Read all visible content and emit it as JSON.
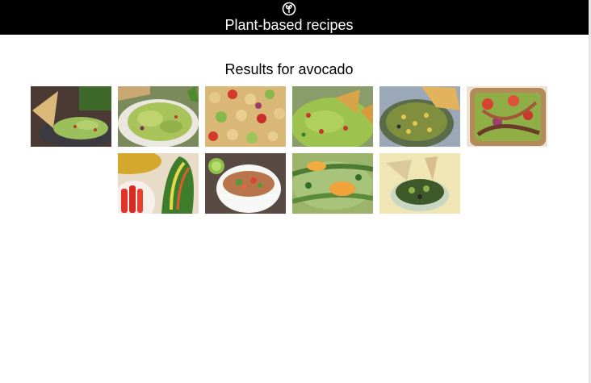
{
  "header": {
    "logo_icon": "leaf-circle-icon",
    "title": "Plant-based recipes",
    "background": "#000000"
  },
  "results": {
    "heading": "Results for avocado",
    "items": [
      {
        "subject": "guacamole with tortilla chip"
      },
      {
        "subject": "chunky guacamole bowl"
      },
      {
        "subject": "chickpea avocado salad"
      },
      {
        "subject": "guacamole with chips"
      },
      {
        "subject": "corn avocado salsa"
      },
      {
        "subject": "avocado toast with tomatoes"
      },
      {
        "subject": "avocado veggie wrap"
      },
      {
        "subject": "quinoa avocado bowl"
      },
      {
        "subject": "avocado orange salad"
      },
      {
        "subject": "avocado salsa with chips"
      }
    ]
  }
}
